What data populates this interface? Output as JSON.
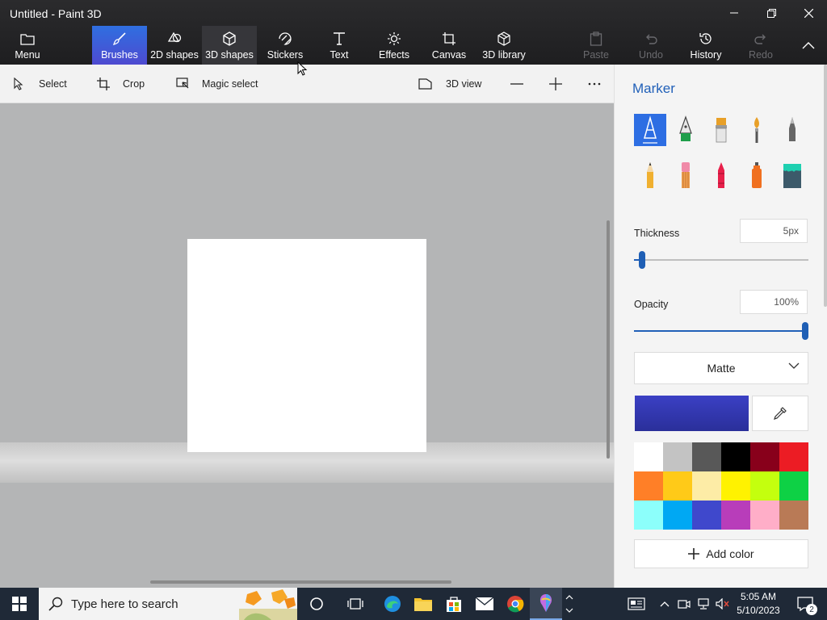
{
  "window": {
    "title": "Untitled - Paint 3D"
  },
  "toolbar": {
    "menu": "Menu",
    "brushes": "Brushes",
    "shapes2d": "2D shapes",
    "shapes3d": "3D shapes",
    "stickers": "Stickers",
    "text": "Text",
    "effects": "Effects",
    "canvas": "Canvas",
    "library3d": "3D library",
    "paste": "Paste",
    "undo": "Undo",
    "history": "History",
    "redo": "Redo"
  },
  "subtoolbar": {
    "select": "Select",
    "crop": "Crop",
    "magic_select": "Magic select",
    "view3d": "3D view"
  },
  "panel": {
    "title": "Marker",
    "thickness_label": "Thickness",
    "thickness_value": "5px",
    "thickness_fraction": 0.03,
    "opacity_label": "Opacity",
    "opacity_value": "100%",
    "opacity_fraction": 1.0,
    "material": "Matte",
    "current_color": "#3b40c4",
    "add_color": "Add color",
    "palette": [
      "#ffffff",
      "#c3c3c3",
      "#585858",
      "#000000",
      "#88001b",
      "#ec1c24",
      "#ff7f27",
      "#ffca18",
      "#fdeca6",
      "#fff200",
      "#c4ff0e",
      "#0ed145",
      "#8cfffb",
      "#00a8f3",
      "#3f48cc",
      "#b83dba",
      "#ffaec8",
      "#b97a56"
    ]
  },
  "taskbar": {
    "search_placeholder": "Type here to search",
    "time": "5:05 AM",
    "date": "5/10/2023",
    "notifications": "2"
  },
  "colors": {
    "accent": "#2d6ee3",
    "panel_title": "#2160b8"
  }
}
